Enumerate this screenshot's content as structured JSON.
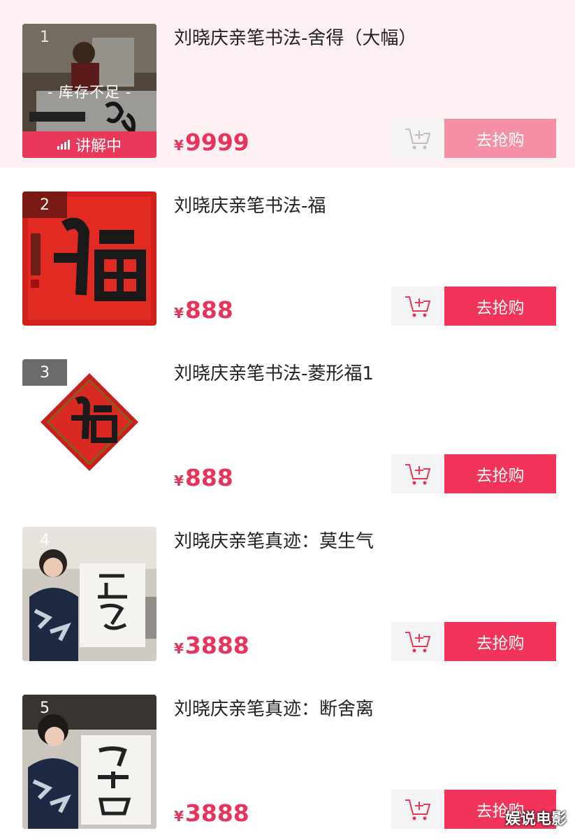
{
  "products": [
    {
      "index": "1",
      "title": "刘晓庆亲笔书法-舍得（大幅）",
      "currency": "¥",
      "price": "9999",
      "stock_label": "- 库存不足 -",
      "live_label": "讲解中",
      "buy_label": "去抢购",
      "thumbnail_icon": "calligraphy-photo"
    },
    {
      "index": "2",
      "title": "刘晓庆亲笔书法-福",
      "currency": "¥",
      "price": "888",
      "buy_label": "去抢购",
      "thumbnail_icon": "fu-calligraphy"
    },
    {
      "index": "3",
      "title": "刘晓庆亲笔书法-菱形福1",
      "currency": "¥",
      "price": "888",
      "buy_label": "去抢购",
      "thumbnail_icon": "diamond-fu"
    },
    {
      "index": "4",
      "title": "刘晓庆亲笔真迹：莫生气",
      "currency": "¥",
      "price": "3888",
      "buy_label": "去抢购",
      "thumbnail_icon": "person-holding-scroll"
    },
    {
      "index": "5",
      "title": "刘晓庆亲笔真迹：断舍离",
      "currency": "¥",
      "price": "3888",
      "buy_label": "去抢购",
      "thumbnail_icon": "person-holding-scroll"
    }
  ],
  "watermark": "娱说电影",
  "colors": {
    "accent": "#f2335a",
    "accent_soft": "#f58fa5",
    "price": "#e8335a",
    "active_row_bg": "#fdf0f3"
  }
}
